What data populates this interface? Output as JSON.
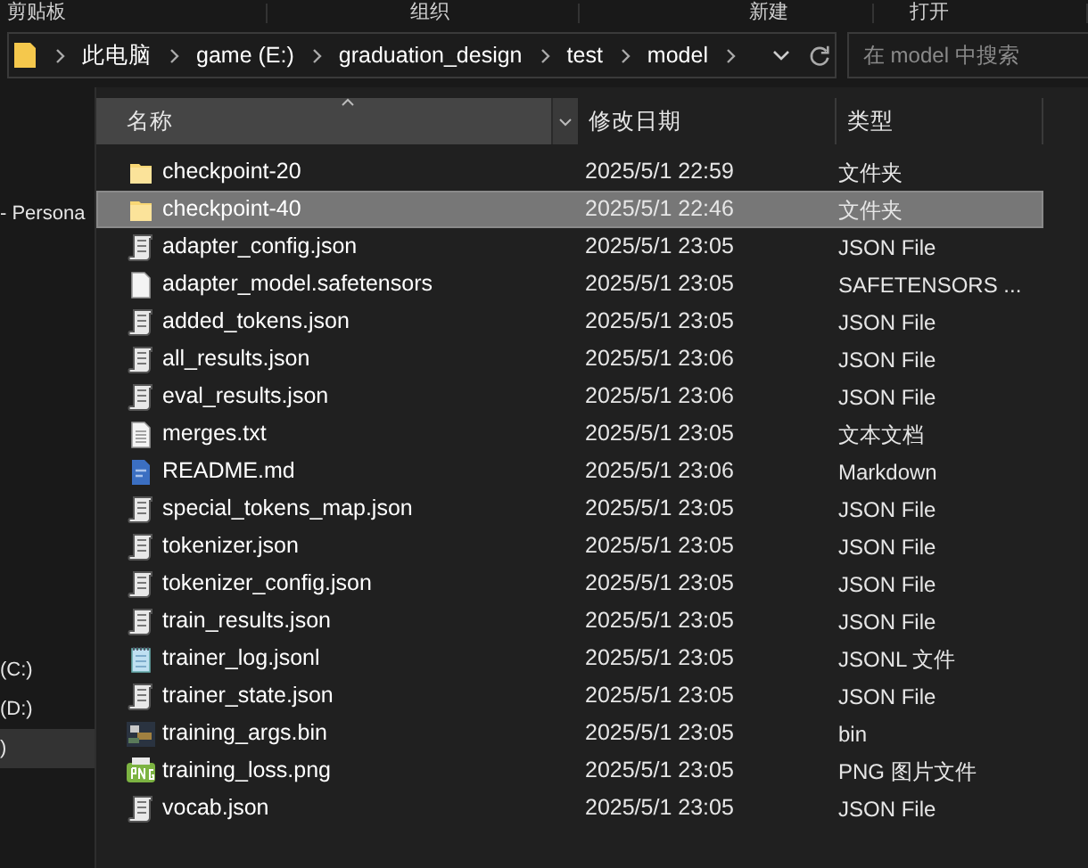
{
  "ribbon_groups": [
    "剪贴板",
    "组织",
    "新建",
    "打开"
  ],
  "address_bar": {
    "crumbs": [
      "此电脑",
      "game (E:)",
      "graduation_design",
      "test",
      "model"
    ]
  },
  "search": {
    "placeholder": "在 model 中搜索"
  },
  "sidebar": {
    "items": [
      {
        "label": "- Persona",
        "selected": false
      },
      {
        "label": "(C:)",
        "selected": false
      },
      {
        "label": "(D:)",
        "selected": false
      },
      {
        "label": ")",
        "selected": true
      }
    ]
  },
  "table": {
    "columns": [
      "名称",
      "修改日期",
      "类型"
    ],
    "rows": [
      {
        "name": "checkpoint-20",
        "date": "2025/5/1 22:59",
        "type": "文件夹",
        "kind": "folder",
        "selected": false
      },
      {
        "name": "checkpoint-40",
        "date": "2025/5/1 22:46",
        "type": "文件夹",
        "kind": "folder",
        "selected": true
      },
      {
        "name": "adapter_config.json",
        "date": "2025/5/1 23:05",
        "type": "JSON File",
        "kind": "script",
        "selected": false
      },
      {
        "name": "adapter_model.safetensors",
        "date": "2025/5/1 23:05",
        "type": "SAFETENSORS ...",
        "kind": "blank",
        "selected": false
      },
      {
        "name": "added_tokens.json",
        "date": "2025/5/1 23:05",
        "type": "JSON File",
        "kind": "script",
        "selected": false
      },
      {
        "name": "all_results.json",
        "date": "2025/5/1 23:06",
        "type": "JSON File",
        "kind": "script",
        "selected": false
      },
      {
        "name": "eval_results.json",
        "date": "2025/5/1 23:06",
        "type": "JSON File",
        "kind": "script",
        "selected": false
      },
      {
        "name": "merges.txt",
        "date": "2025/5/1 23:05",
        "type": "文本文档",
        "kind": "text",
        "selected": false
      },
      {
        "name": "README.md",
        "date": "2025/5/1 23:06",
        "type": "Markdown",
        "kind": "markdown",
        "selected": false
      },
      {
        "name": "special_tokens_map.json",
        "date": "2025/5/1 23:05",
        "type": "JSON File",
        "kind": "script",
        "selected": false
      },
      {
        "name": "tokenizer.json",
        "date": "2025/5/1 23:05",
        "type": "JSON File",
        "kind": "script",
        "selected": false
      },
      {
        "name": "tokenizer_config.json",
        "date": "2025/5/1 23:05",
        "type": "JSON File",
        "kind": "script",
        "selected": false
      },
      {
        "name": "train_results.json",
        "date": "2025/5/1 23:05",
        "type": "JSON File",
        "kind": "script",
        "selected": false
      },
      {
        "name": "trainer_log.jsonl",
        "date": "2025/5/1 23:05",
        "type": "JSONL 文件",
        "kind": "notepad",
        "selected": false
      },
      {
        "name": "trainer_state.json",
        "date": "2025/5/1 23:05",
        "type": "JSON File",
        "kind": "script",
        "selected": false
      },
      {
        "name": "training_args.bin",
        "date": "2025/5/1 23:05",
        "type": "bin",
        "kind": "bin",
        "selected": false
      },
      {
        "name": "training_loss.png",
        "date": "2025/5/1 23:05",
        "type": "PNG 图片文件",
        "kind": "png",
        "selected": false
      },
      {
        "name": "vocab.json",
        "date": "2025/5/1 23:05",
        "type": "JSON File",
        "kind": "script",
        "selected": false
      }
    ]
  }
}
